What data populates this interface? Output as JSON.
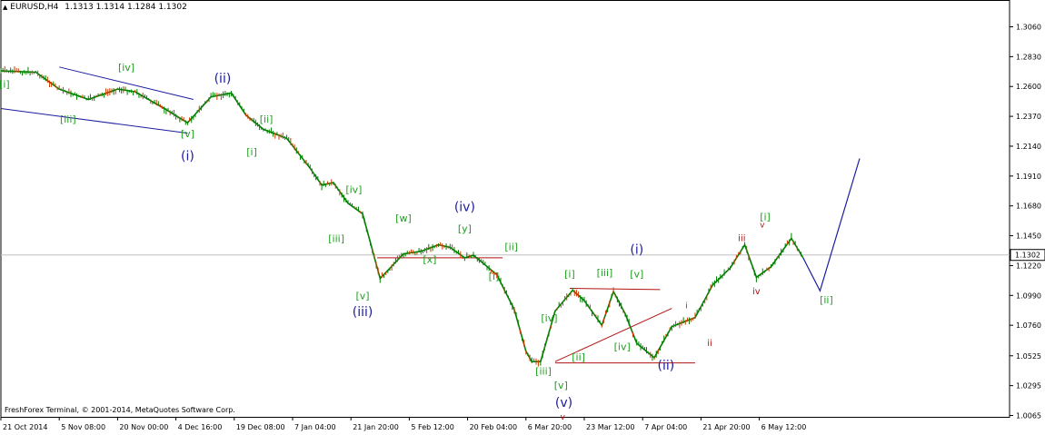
{
  "header": {
    "symbol": "EURUSD,H4",
    "ohlc": "1.1313 1.1314 1.1284 1.1302"
  },
  "footer": {
    "copyright": "FreshForex Terminal, © 2001-2014, MetaQuotes Software Corp."
  },
  "colors": {
    "candle": "#008000",
    "candle_down": "#d03a00",
    "wave_blue": "#1c1ca0",
    "wave_green": "#1fa01f",
    "wave_red": "#b31212",
    "current_line": "#c0c0c0",
    "price_label_bg": "#ffffff"
  },
  "chart_data": {
    "type": "line",
    "title": "EURUSD,H4",
    "xlabel": "",
    "ylabel": "",
    "ylim": [
      1.0065,
      1.3145
    ],
    "x_tick_labels": [
      "21 Oct 2014",
      "5 Nov 08:00",
      "20 Nov 00:00",
      "4 Dec 16:00",
      "19 Dec 08:00",
      "7 Jan 04:00",
      "21 Jan 20:00",
      "5 Feb 12:00",
      "20 Feb 04:00",
      "6 Mar 20:00",
      "23 Mar 12:00",
      "7 Apr 04:00",
      "21 Apr 20:00",
      "6 May 12:00"
    ],
    "y_tick_labels": [
      "1.3060",
      "1.2830",
      "1.2600",
      "1.2370",
      "1.2140",
      "1.1910",
      "1.1680",
      "1.1450",
      "1.1220",
      "1.0990",
      "1.0760",
      "1.0525",
      "1.0295",
      "1.0065"
    ],
    "y_ticks": [
      1.306,
      1.283,
      1.26,
      1.237,
      1.214,
      1.191,
      1.168,
      1.145,
      1.122,
      1.099,
      1.076,
      1.0525,
      1.0295,
      1.0065
    ],
    "current_price": 1.1302,
    "current_price_label": "1.1302",
    "grid": false,
    "series": [
      {
        "x_idx": [
          0,
          0.6,
          1.0,
          1.5,
          2.0,
          2.3,
          2.8,
          3.2,
          3.6,
          3.95,
          4.2,
          4.5,
          4.9,
          5.3,
          5.5,
          5.7,
          5.95,
          6.2,
          6.5,
          6.9,
          7.2,
          7.5,
          7.7,
          7.95,
          8.1,
          8.5,
          8.8,
          9.0,
          9.1,
          9.25,
          9.5,
          9.8,
          10.0,
          10.3,
          10.5,
          10.7,
          10.9,
          11.2,
          11.5,
          11.9,
          12.2,
          12.5,
          12.75,
          12.95,
          13.2,
          13.55,
          13.75
        ],
        "y": [
          1.272,
          1.271,
          1.258,
          1.25,
          1.258,
          1.256,
          1.243,
          1.232,
          1.252,
          1.255,
          1.238,
          1.227,
          1.22,
          1.197,
          1.184,
          1.186,
          1.17,
          1.162,
          1.112,
          1.131,
          1.133,
          1.138,
          1.136,
          1.128,
          1.13,
          1.115,
          1.088,
          1.056,
          1.048,
          1.048,
          1.087,
          1.103,
          1.095,
          1.076,
          1.102,
          1.085,
          1.062,
          1.051,
          1.075,
          1.082,
          1.107,
          1.12,
          1.138,
          1.113,
          1.121,
          1.143,
          1.128
        ]
      },
      {
        "name": "",
        "x_idx": [
          13.75,
          14.04,
          14.72
        ],
        "y": [
          1.128,
          1.1025,
          1.2045
        ]
      }
    ]
  },
  "labels": [
    {
      "text": "[i]",
      "wave": "green",
      "x_idx": 0.06,
      "y": 1.259
    },
    {
      "text": "[iii]",
      "wave": "green",
      "x_idx": 1.15,
      "y": 1.232
    },
    {
      "text": "[iv]",
      "wave": "green",
      "x_idx": 2.15,
      "y": 1.272
    },
    {
      "text": "[v]",
      "wave": "green",
      "x_idx": 3.2,
      "y": 1.221
    },
    {
      "text": "(i)",
      "wave": "blue",
      "x_idx": 3.2,
      "y": 1.203
    },
    {
      "text": "(ii)",
      "wave": "blue",
      "x_idx": 3.8,
      "y": 1.263
    },
    {
      "text": "[ii]",
      "wave": "green",
      "x_idx": 4.55,
      "y": 1.232
    },
    {
      "text": "[i]",
      "wave": "green",
      "x_idx": 4.3,
      "y": 1.207
    },
    {
      "text": "[iv]",
      "wave": "green",
      "x_idx": 6.05,
      "y": 1.178
    },
    {
      "text": "[iii]",
      "wave": "green",
      "x_idx": 5.75,
      "y": 1.14
    },
    {
      "text": "[v]",
      "wave": "green",
      "x_idx": 6.2,
      "y": 1.096
    },
    {
      "text": "(iii)",
      "wave": "blue",
      "x_idx": 6.2,
      "y": 1.083
    },
    {
      "text": "[w]",
      "wave": "green",
      "x_idx": 6.9,
      "y": 1.156
    },
    {
      "text": "[x]",
      "wave": "green",
      "x_idx": 7.35,
      "y": 1.124
    },
    {
      "text": "[y]",
      "wave": "green",
      "x_idx": 7.95,
      "y": 1.148
    },
    {
      "text": "(iv)",
      "wave": "blue",
      "x_idx": 7.95,
      "y": 1.164
    },
    {
      "text": "[ii]",
      "wave": "green",
      "x_idx": 8.75,
      "y": 1.134
    },
    {
      "text": "[i]",
      "wave": "green",
      "x_idx": 8.45,
      "y": 1.111
    },
    {
      "text": "[i]",
      "wave": "green",
      "x_idx": 9.75,
      "y": 1.113
    },
    {
      "text": "[iii]",
      "wave": "green",
      "x_idx": 10.35,
      "y": 1.114
    },
    {
      "text": "[v]",
      "wave": "green",
      "x_idx": 10.9,
      "y": 1.113
    },
    {
      "text": "(i)",
      "wave": "blue",
      "x_idx": 10.9,
      "y": 1.131
    },
    {
      "text": "[iv]",
      "wave": "green",
      "x_idx": 9.4,
      "y": 1.079
    },
    {
      "text": "[iv]",
      "wave": "green",
      "x_idx": 10.65,
      "y": 1.057
    },
    {
      "text": "[ii]",
      "wave": "green",
      "x_idx": 9.9,
      "y": 1.049
    },
    {
      "text": "[iii]",
      "wave": "green",
      "x_idx": 9.3,
      "y": 1.038
    },
    {
      "text": "[v]",
      "wave": "green",
      "x_idx": 9.6,
      "y": 1.027
    },
    {
      "text": "(v)",
      "wave": "blue",
      "x_idx": 9.65,
      "y": 1.013
    },
    {
      "text": "(ii)",
      "wave": "blue",
      "x_idx": 11.4,
      "y": 1.042
    },
    {
      "text": "ii",
      "wave": "red",
      "x_idx": 12.15,
      "y": 1.06
    },
    {
      "text": "iii",
      "wave": "red",
      "x_idx": 12.7,
      "y": 1.141
    },
    {
      "text": "iv",
      "wave": "red",
      "x_idx": 12.95,
      "y": 1.1
    },
    {
      "text": "[i]",
      "wave": "green",
      "x_idx": 13.1,
      "y": 1.157
    },
    {
      "text": "[ii]",
      "wave": "green",
      "x_idx": 14.15,
      "y": 1.093
    }
  ],
  "annotations": {
    "blue_channel": [
      {
        "x1_idx": 0.0,
        "y1": 1.243,
        "x2_idx": 3.2,
        "y2": 1.224
      },
      {
        "x1_idx": 1.0,
        "y1": 1.275,
        "x2_idx": 3.3,
        "y2": 1.25
      }
    ],
    "red_lines": [
      {
        "x1_idx": 6.45,
        "y1": 1.128,
        "x2_idx": 8.6,
        "y2": 1.128
      },
      {
        "x1_idx": 9.75,
        "y1": 1.1045,
        "x2_idx": 11.3,
        "y2": 1.1035
      },
      {
        "x1_idx": 9.5,
        "y1": 1.047,
        "x2_idx": 11.9,
        "y2": 1.047
      },
      {
        "x1_idx": 9.5,
        "y1": 1.048,
        "x2_idx": 11.5,
        "y2": 1.089
      }
    ],
    "small_red_marks": [
      {
        "text": "v",
        "x_idx": 13.05,
        "y": 1.1515
      },
      {
        "text": "i",
        "x_idx": 11.75,
        "y": 1.089
      },
      {
        "text": "v",
        "x_idx": 9.63,
        "y": 1.0035
      }
    ]
  }
}
